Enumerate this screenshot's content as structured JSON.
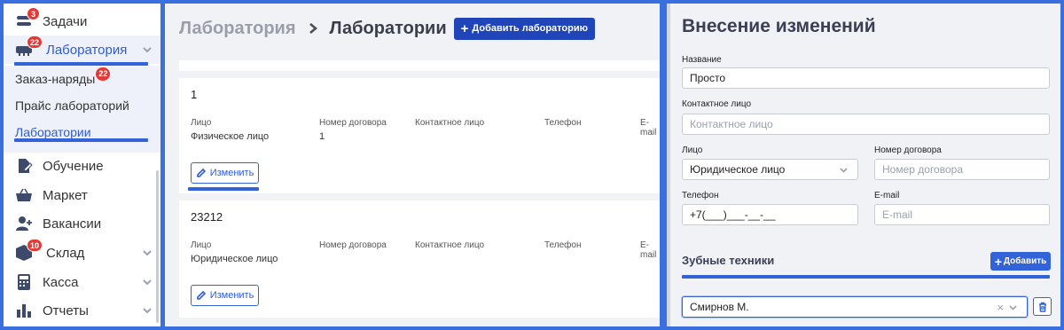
{
  "sidebar": {
    "tasks": {
      "label": "Задачи",
      "badge": "3",
      "icon": "tasks-icon"
    },
    "laboratory": {
      "label": "Лаборатория",
      "badge": "22",
      "icon": "laboratory-icon"
    },
    "sub": {
      "orders": {
        "label": "Заказ-наряды",
        "badge": "22"
      },
      "price": {
        "label": "Прайс лабораторий"
      },
      "labs": {
        "label": "Лаборатории"
      }
    },
    "education": {
      "label": "Обучение",
      "icon": "education-icon"
    },
    "market": {
      "label": "Маркет",
      "icon": "basket-icon"
    },
    "vacancies": {
      "label": "Вакансии",
      "icon": "add-user-icon"
    },
    "warehouse": {
      "label": "Склад",
      "badge": "10",
      "icon": "box-icon"
    },
    "cash": {
      "label": "Касса",
      "icon": "calculator-icon"
    },
    "reports": {
      "label": "Отчеты",
      "icon": "bar-chart-icon"
    }
  },
  "labs": {
    "breadcrumb_parent": "Лаборатория",
    "breadcrumb_current": "Лаборатории",
    "add_button": "Добавить лабораторию",
    "columns": {
      "face": "Лицо",
      "contract": "Номер договора",
      "contact": "Контактное лицо",
      "phone": "Телефон",
      "email": "E-mail"
    },
    "edit_label": "Изменить",
    "cards": [
      {
        "name": "1",
        "face": "Физическое лицо",
        "contract": "1"
      },
      {
        "name": "23212",
        "face": "Юридическое лицо",
        "contract": ""
      }
    ]
  },
  "form": {
    "title": "Внесение изменений",
    "name_label": "Название",
    "name_value": "Просто",
    "contact_label": "Контактное лицо",
    "contact_placeholder": "Контактное лицо",
    "face_label": "Лицо",
    "face_value": "Юридическое лицо",
    "contract_label": "Номер договора",
    "contract_placeholder": "Номер договора",
    "phone_label": "Телефон",
    "phone_value": "+7(___)___-__-__",
    "email_label": "E-mail",
    "email_placeholder": "E-mail",
    "technicians_title": "Зубные техники",
    "add_label": "Добавить",
    "technician_value": "Смирнов М."
  },
  "colors": {
    "accent": "#3363d8",
    "badge": "#e53935",
    "frame": "#3a6fe0"
  }
}
